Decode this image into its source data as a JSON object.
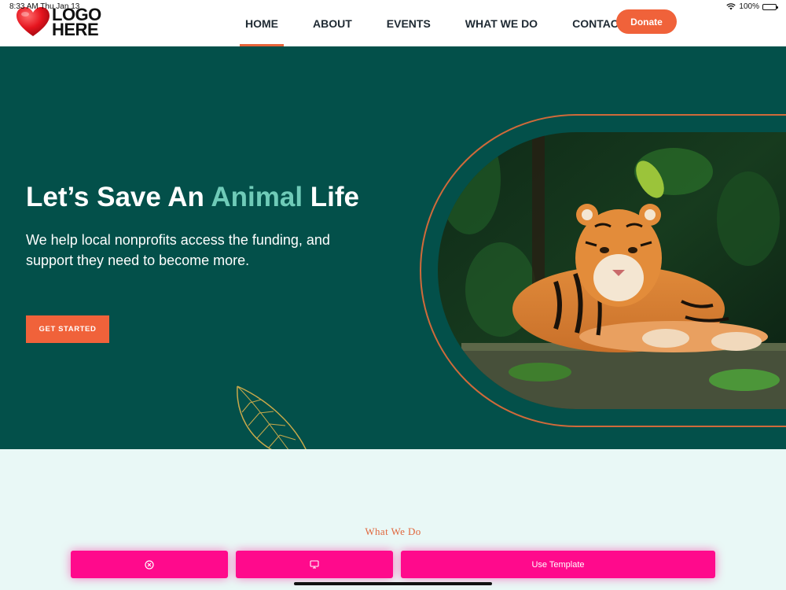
{
  "status_bar": {
    "time": "8:33 AM   Thu Jan 13",
    "battery": "100%",
    "battery_level": 1.0
  },
  "logo": {
    "line1": "LOGO",
    "line2": "HERE"
  },
  "nav": {
    "items": [
      {
        "label": "HOME",
        "active": true
      },
      {
        "label": "ABOUT"
      },
      {
        "label": "EVENTS"
      },
      {
        "label": "WHAT WE DO"
      },
      {
        "label": "CONTACT"
      }
    ],
    "donate": "Donate"
  },
  "hero": {
    "title_before": "Let’s Save An ",
    "title_accent": "Animal",
    "title_after": " Life",
    "subtitle": "We help local nonprofits access the funding, and support they need to become more.",
    "cta": "GET STARTED"
  },
  "section": {
    "label": "What We Do"
  },
  "toolbar": {
    "close_icon": "close-circle-icon",
    "preview_icon": "monitor-icon",
    "use_template": "Use Template"
  },
  "colors": {
    "accent": "#f0623a",
    "hero_bg": "#03504a",
    "highlight": "#6fcbb8",
    "section_bg": "#e9f8f6",
    "toolbar": "#ff0a8c"
  }
}
